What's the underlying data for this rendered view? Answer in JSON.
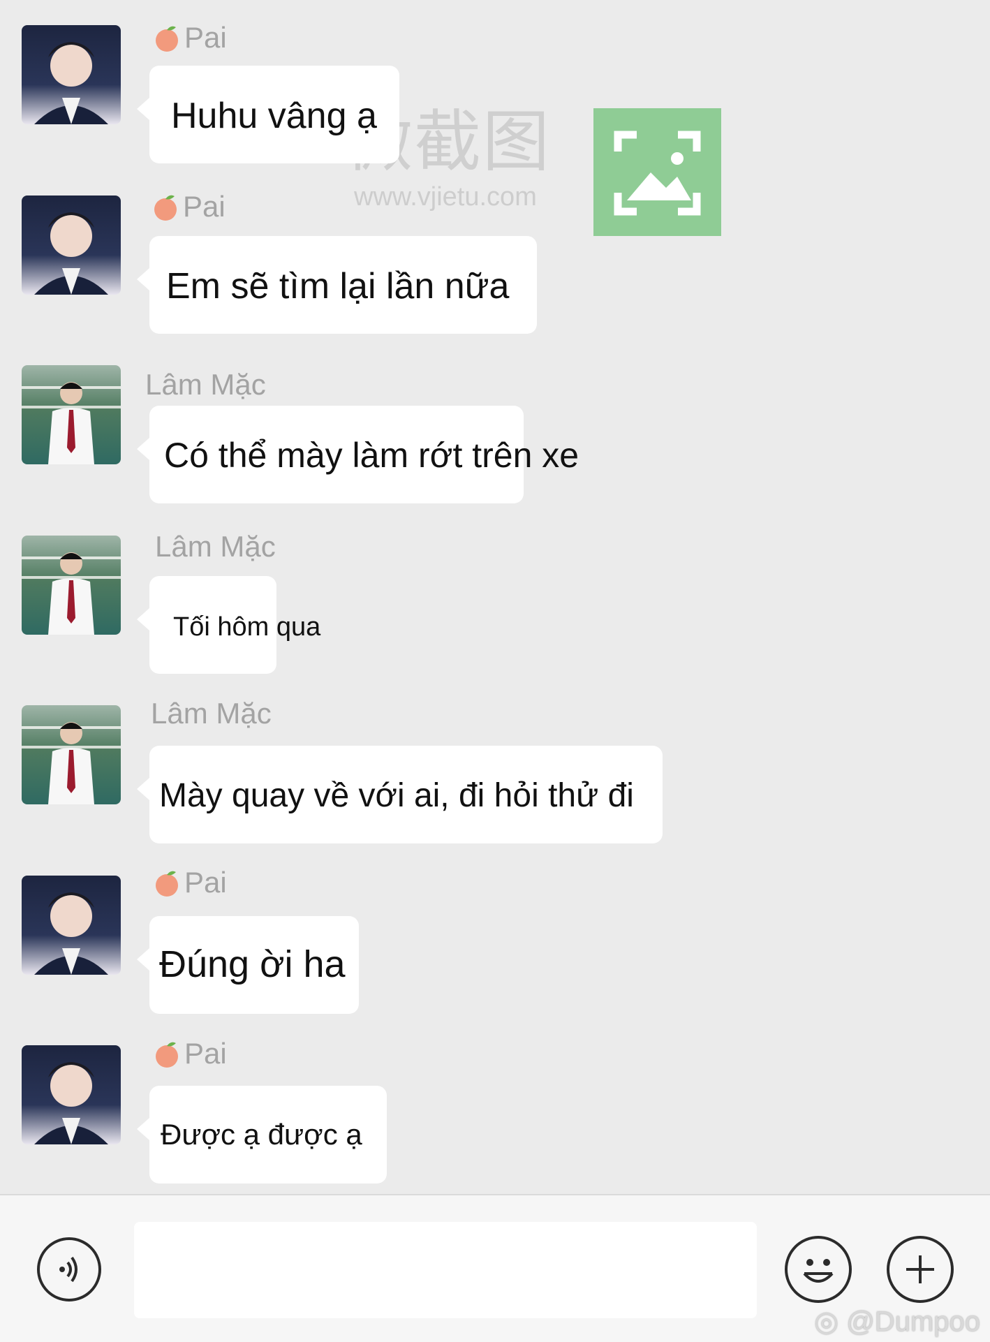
{
  "watermark": {
    "text": "微截图",
    "url": "www.vjietu.com"
  },
  "messages": [
    {
      "sender": "Pai",
      "emoji": "🍑",
      "text": "Huhu vâng ạ"
    },
    {
      "sender": "Pai",
      "emoji": "🍑",
      "text": "Em sẽ tìm lại lần nữa"
    },
    {
      "sender": "Lâm Mặc",
      "emoji": "",
      "text": "Có thể mày làm rớt trên xe"
    },
    {
      "sender": "Lâm Mặc",
      "emoji": "",
      "text": "Tối hôm qua"
    },
    {
      "sender": "Lâm Mặc",
      "emoji": "",
      "text": "Mày quay về với ai, đi hỏi thử đi"
    },
    {
      "sender": "Pai",
      "emoji": "🍑",
      "text": "Đúng ời ha"
    },
    {
      "sender": "Pai",
      "emoji": "🍑",
      "text": "Được ạ được ạ"
    }
  ],
  "input_bar": {
    "voice_icon": "voice-icon",
    "emoji_icon": "smiley-icon",
    "plus_icon": "plus-icon",
    "value": ""
  },
  "footer": {
    "handle": "@Dumpoo"
  },
  "colors": {
    "background": "#ebebeb",
    "bubble": "#ffffff",
    "sender_name": "#a3a3a3",
    "watermark_box": "#8fcc95"
  }
}
